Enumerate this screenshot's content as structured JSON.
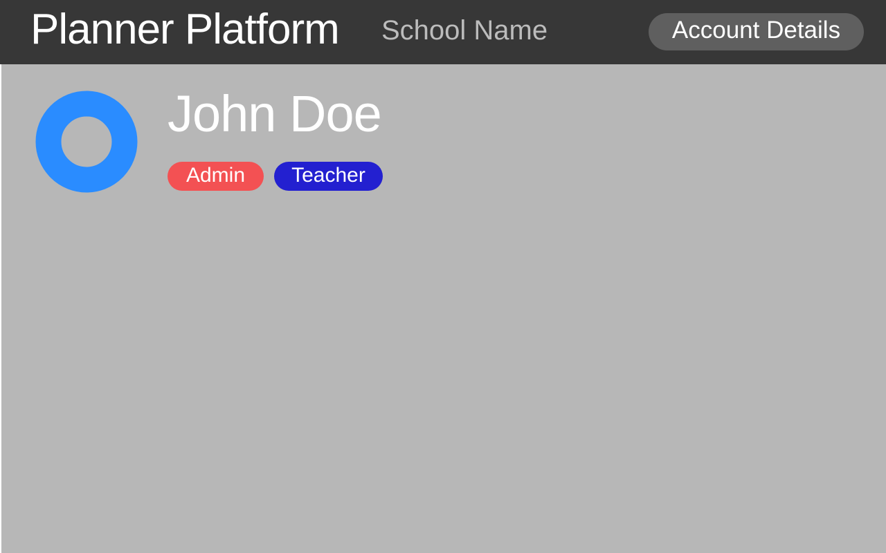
{
  "header": {
    "app_title": "Planner Platform",
    "school_name": "School Name",
    "account_button_label": "Account Details"
  },
  "profile": {
    "name": "John Doe",
    "avatar_icon": "ring-avatar-icon",
    "avatar_color": "#2A8CFF",
    "roles": [
      {
        "label": "Admin",
        "color": "#F35153"
      },
      {
        "label": "Teacher",
        "color": "#2320D0"
      }
    ]
  },
  "colors": {
    "header_bg": "#373737",
    "content_bg": "#B7B7B7",
    "account_button_bg": "#5F5F5F"
  }
}
